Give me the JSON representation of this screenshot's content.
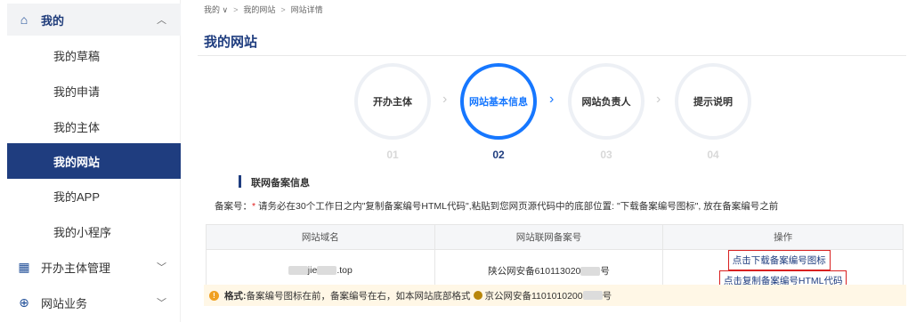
{
  "sidebar": {
    "top": {
      "label": "我的",
      "icon": "home-icon"
    },
    "items": [
      {
        "label": "我的草稿"
      },
      {
        "label": "我的申请"
      },
      {
        "label": "我的主体"
      },
      {
        "label": "我的网站"
      },
      {
        "label": "我的APP"
      },
      {
        "label": "我的小程序"
      }
    ],
    "groups": [
      {
        "label": "开办主体管理",
        "icon": "building-icon"
      },
      {
        "label": "网站业务",
        "icon": "globe-icon"
      }
    ]
  },
  "breadcrumb": {
    "root": "我的 ∨",
    "sep": ">",
    "level2": "我的网站",
    "level3": "网站详情"
  },
  "page_title": "我的网站",
  "steps": [
    {
      "label": "开办主体",
      "num": "01"
    },
    {
      "label": "网站基本信息",
      "num": "02"
    },
    {
      "label": "网站负责人",
      "num": "03"
    },
    {
      "label": "提示说明",
      "num": "04"
    }
  ],
  "section_title": "联网备案信息",
  "note": {
    "prefix": "备案号：",
    "star": "*",
    "text": " 请务必在30个工作日之内\"复制备案编号HTML代码\",粘贴到您网页源代码中的底部位置: \"下载备案编号图标\", 放在备案编号之前"
  },
  "table": {
    "headers": [
      "网站域名",
      "网站联网备案号",
      "操作"
    ],
    "domain_pre": "jie",
    "domain_suf": ".top",
    "record_pre": "陕公网安备610113020",
    "record_suf": "号",
    "op_download": "点击下载备案编号图标",
    "op_copy": "点击复制备案编号HTML代码"
  },
  "tip": {
    "label": "格式:",
    "text": " 备案编号图标在前，备案编号在右，如本网站底部格式",
    "example_pre": "京公网安备1101010200",
    "example_suf": "号"
  },
  "colors": {
    "primary": "#1f3d7f",
    "accent": "#1677ff",
    "highlight": "#d92020"
  }
}
